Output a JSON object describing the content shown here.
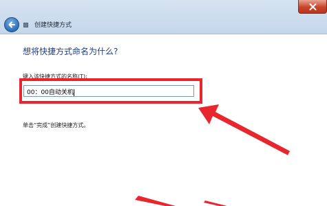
{
  "window": {
    "title": "创建快捷方式"
  },
  "main": {
    "heading": "想将快捷方式命名为什么?",
    "field_label_text": "键入该快捷方式的名称(",
    "field_label_accel": "T",
    "field_label_suffix": "):",
    "input_value": "00：00自动关机",
    "hint": "单击“完成”创建快捷方式。"
  },
  "colors": {
    "annotation": "#e8262d",
    "heading": "#1f3d8a"
  },
  "icons": {
    "back": "back-arrow-icon",
    "window": "shortcut-wizard-icon",
    "close": "close-icon"
  }
}
